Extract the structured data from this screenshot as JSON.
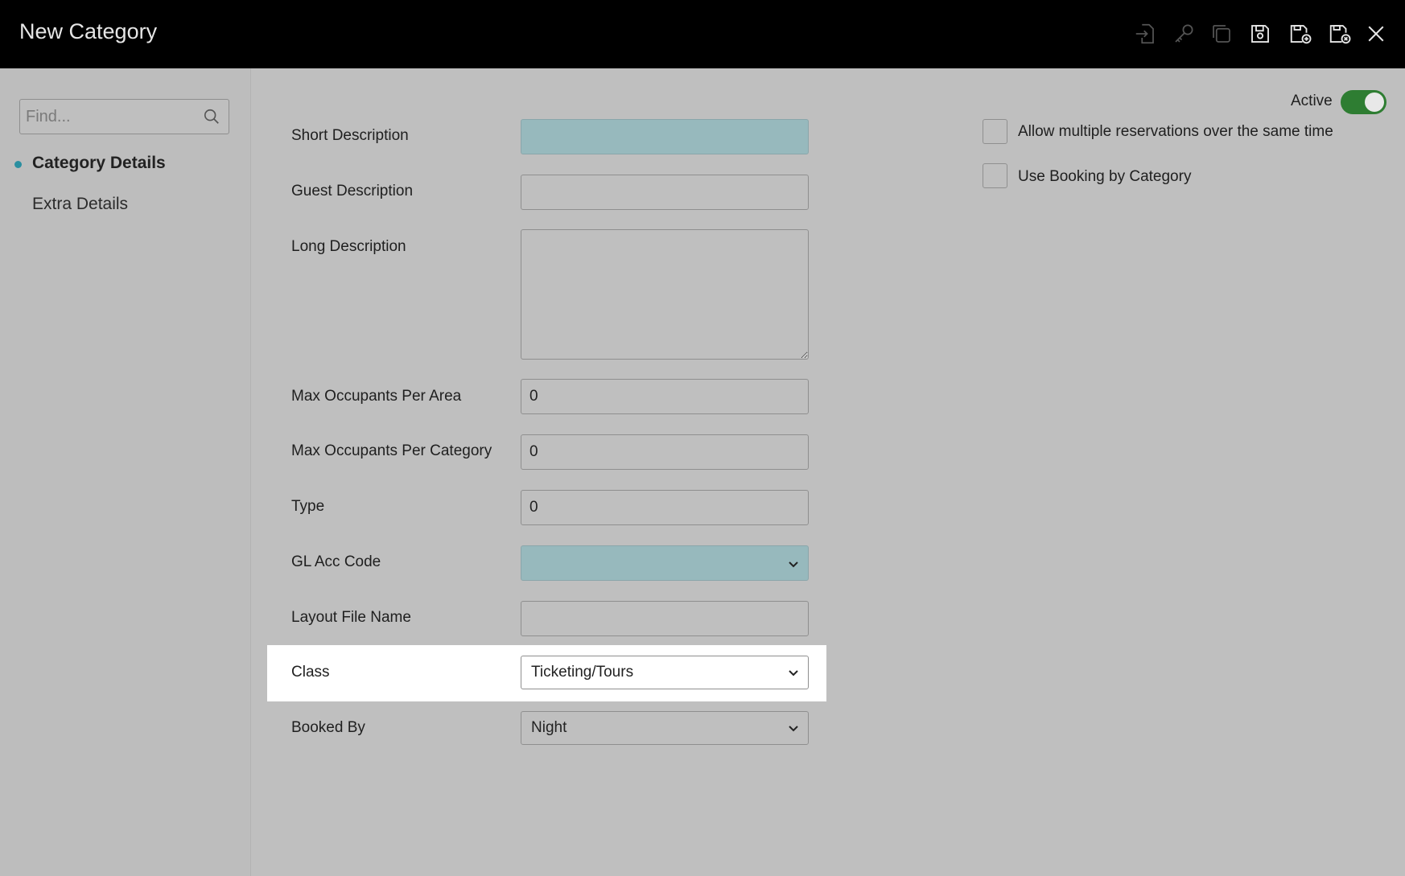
{
  "header": {
    "title": "New Category",
    "icons": [
      "import-icon",
      "key-icon",
      "copy-icon",
      "save-icon",
      "save-new-icon",
      "save-close-icon",
      "close-icon"
    ]
  },
  "sidebar": {
    "search_placeholder": "Find...",
    "items": [
      {
        "label": "Category Details",
        "active": true
      },
      {
        "label": "Extra Details",
        "active": false
      }
    ]
  },
  "form": {
    "short_description": {
      "label": "Short Description",
      "value": ""
    },
    "guest_description": {
      "label": "Guest Description",
      "value": ""
    },
    "long_description": {
      "label": "Long Description",
      "value": ""
    },
    "max_occupants_area": {
      "label": "Max Occupants Per Area",
      "value": "0"
    },
    "max_occupants_category": {
      "label": "Max Occupants Per Category",
      "value": "0"
    },
    "type": {
      "label": "Type",
      "value": "0"
    },
    "gl_acc_code": {
      "label": "GL Acc Code",
      "value": ""
    },
    "layout_file_name": {
      "label": "Layout File Name",
      "value": ""
    },
    "class": {
      "label": "Class",
      "value": "Ticketing/Tours"
    },
    "booked_by": {
      "label": "Booked By",
      "value": "Night"
    }
  },
  "options": {
    "active_label": "Active",
    "active": true,
    "allow_multiple": {
      "label": "Allow multiple reservations over the same time",
      "checked": false
    },
    "booking_by_category": {
      "label": "Use Booking by Category",
      "checked": false
    }
  },
  "colors": {
    "header_bg": "#000000",
    "background": "#bfbfbf",
    "required_field": "#97b9bd",
    "toggle_on": "#2e7d32",
    "nav_dot": "#2a8fa0",
    "highlight": "#ffffff"
  }
}
